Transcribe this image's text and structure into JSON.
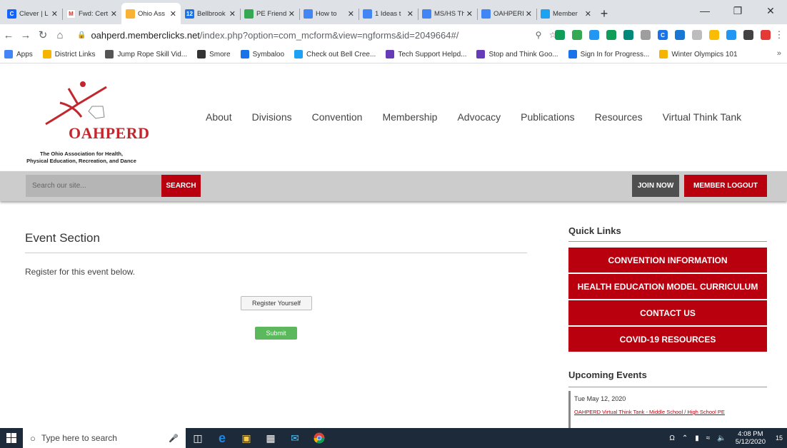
{
  "browser": {
    "tabs": [
      {
        "title": "Clever | L",
        "fav_color": "#1464ff",
        "fav_letter": "C"
      },
      {
        "title": "Fwd: Cert",
        "fav_color": "#ffffff",
        "fav_letter": "M"
      },
      {
        "title": "Ohio Ass",
        "fav_color": "#f9b233",
        "fav_letter": ""
      },
      {
        "title": "Bellbrook",
        "fav_color": "#1a73e8",
        "fav_letter": "12"
      },
      {
        "title": "PE Friend",
        "fav_color": "#34a853",
        "fav_letter": ""
      },
      {
        "title": "How to",
        "fav_color": "#4285f4",
        "fav_letter": ""
      },
      {
        "title": "1 Ideas t",
        "fav_color": "#4285f4",
        "fav_letter": ""
      },
      {
        "title": "MS/HS Th",
        "fav_color": "#4285f4",
        "fav_letter": ""
      },
      {
        "title": "OAHPERI",
        "fav_color": "#4285f4",
        "fav_letter": ""
      },
      {
        "title": "Member",
        "fav_color": "#1da1f2",
        "fav_letter": ""
      }
    ],
    "active_tab_index": 2,
    "url_host": "oahperd.memberclicks.net",
    "url_path": "/index.php?option=com_mcform&view=ngforms&id=2049664#/",
    "bookmarks": [
      {
        "label": "Apps",
        "color": "#4285f4"
      },
      {
        "label": "District Links",
        "color": "#f4b400"
      },
      {
        "label": "Jump Rope Skill Vid...",
        "color": "#555555"
      },
      {
        "label": "Smore",
        "color": "#333333"
      },
      {
        "label": "Symbaloo",
        "color": "#1a73e8"
      },
      {
        "label": "Check out Bell Cree...",
        "color": "#1da1f2"
      },
      {
        "label": "Tech Support Helpd...",
        "color": "#673ab7"
      },
      {
        "label": "Stop and Think Goo...",
        "color": "#673ab7"
      },
      {
        "label": "Sign In for Progress...",
        "color": "#1a73e8"
      },
      {
        "label": "Winter Olympics 101",
        "color": "#f4b400"
      }
    ]
  },
  "site": {
    "logo_name": "OAHPERD",
    "logo_subtitle_1": "The Ohio Association for Health,",
    "logo_subtitle_2": "Physical Education, Recreation, and Dance",
    "nav": [
      "About",
      "Divisions",
      "Convention",
      "Membership",
      "Advocacy",
      "Publications",
      "Resources",
      "Virtual Think Tank"
    ],
    "search_placeholder": "Search our site...",
    "search_button": "SEARCH",
    "join_button": "JOIN NOW",
    "logout_button": "MEMBER LOGOUT",
    "brand_red": "#b8000f"
  },
  "main": {
    "title": "Event Section",
    "note": "Register for this event below.",
    "register_label": "Register Yourself",
    "submit_label": "Submit"
  },
  "sidebar": {
    "quick_links_title": "Quick Links",
    "quick_links": [
      "CONVENTION INFORMATION",
      "HEALTH EDUCATION MODEL CURRICULUM",
      "CONTACT US",
      "COVID-19 RESOURCES"
    ],
    "upcoming_title": "Upcoming Events",
    "event_date": "Tue May 12, 2020",
    "event_link": "OAHPERD Virtual Think Tank - Middle School / High School PE"
  },
  "taskbar": {
    "search_placeholder": "Type here to search",
    "time": "4:08 PM",
    "date": "5/12/2020",
    "notif_count": "15"
  }
}
